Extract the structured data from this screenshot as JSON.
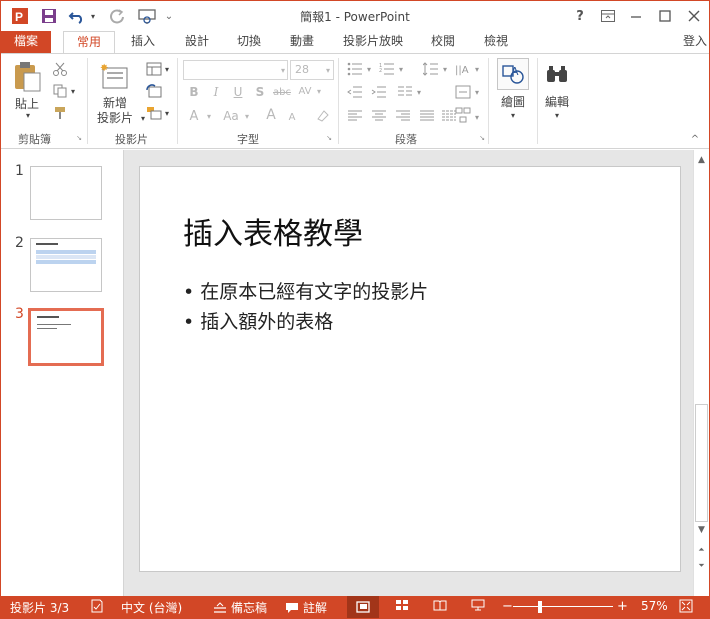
{
  "window": {
    "title": "簡報1 - PowerPoint",
    "help": "?"
  },
  "tabs": [
    {
      "label": "檔案"
    },
    {
      "label": "常用"
    },
    {
      "label": "插入"
    },
    {
      "label": "設計"
    },
    {
      "label": "切換"
    },
    {
      "label": "動畫"
    },
    {
      "label": "投影片放映"
    },
    {
      "label": "校閱"
    },
    {
      "label": "檢視"
    }
  ],
  "signin": "登入",
  "ribbon": {
    "clipboard": {
      "paste": "貼上",
      "group": "剪貼簿"
    },
    "slides": {
      "new_slide_1": "新增",
      "new_slide_2": "投影片",
      "group": "投影片"
    },
    "font": {
      "font_name": "",
      "font_size": "28",
      "group": "字型"
    },
    "paragraph": {
      "group": "段落"
    },
    "drawing": {
      "label": "繪圖"
    },
    "editing": {
      "label": "編輯"
    }
  },
  "thumbnails": [
    {
      "num": "1"
    },
    {
      "num": "2"
    },
    {
      "num": "3"
    }
  ],
  "slide": {
    "title": "插入表格教學",
    "bullets": [
      "在原本已經有文字的投影片",
      "插入額外的表格"
    ]
  },
  "status": {
    "slide_info": "投影片 3/3",
    "language": "中文 (台灣)",
    "notes": "備忘稿",
    "comments": "註解",
    "zoom": "57%",
    "zoom_minus": "−",
    "zoom_plus": "+"
  },
  "colors": {
    "accent": "#d24726",
    "selected_thumb": "#e46c52"
  }
}
